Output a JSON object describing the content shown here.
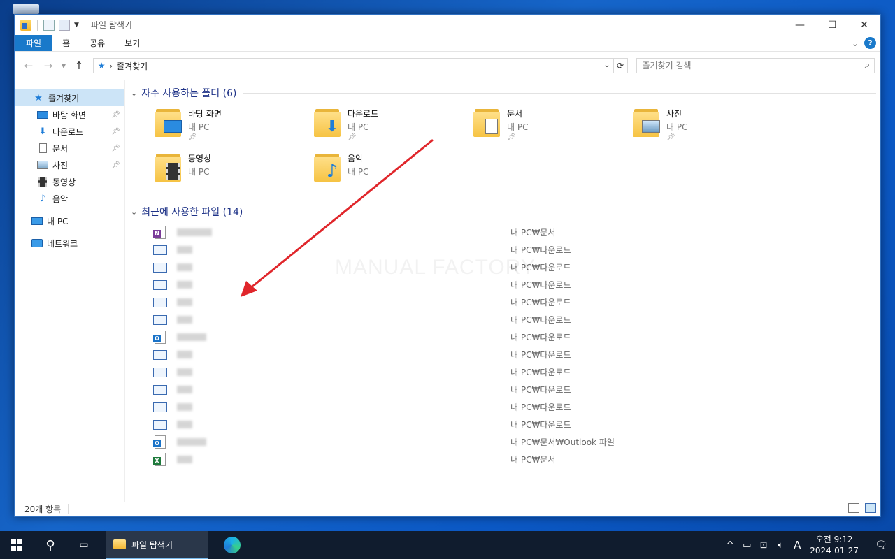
{
  "window": {
    "title": "파일 탐색기",
    "controls": {
      "minimize": "—",
      "maximize": "☐",
      "close": "✕"
    }
  },
  "ribbon": {
    "tabs": [
      "파일",
      "홈",
      "공유",
      "보기"
    ],
    "active_tab": "파일",
    "help": "?"
  },
  "address": {
    "crumb": "즐겨찾기",
    "search_placeholder": "즐겨찾기 검색"
  },
  "nav": {
    "quick_access": "즐겨찾기",
    "items": [
      {
        "label": "바탕 화면",
        "icon": "desktop-icon",
        "pinned": true
      },
      {
        "label": "다운로드",
        "icon": "download-icon",
        "pinned": true
      },
      {
        "label": "문서",
        "icon": "document-icon",
        "pinned": true
      },
      {
        "label": "사진",
        "icon": "picture-icon",
        "pinned": true
      },
      {
        "label": "동영상",
        "icon": "video-icon",
        "pinned": false
      },
      {
        "label": "음악",
        "icon": "music-icon",
        "pinned": false
      }
    ],
    "this_pc": "내 PC",
    "network": "네트워크"
  },
  "frequent": {
    "header": "자주 사용하는 폴더 (6)",
    "folders": [
      {
        "name": "바탕 화면",
        "sub": "내 PC",
        "pinned": true,
        "overlay": "desktop-icon"
      },
      {
        "name": "다운로드",
        "sub": "내 PC",
        "pinned": true,
        "overlay": "download-icon"
      },
      {
        "name": "문서",
        "sub": "내 PC",
        "pinned": true,
        "overlay": "document-icon"
      },
      {
        "name": "사진",
        "sub": "내 PC",
        "pinned": true,
        "overlay": "picture-icon"
      },
      {
        "name": "동영상",
        "sub": "내 PC",
        "pinned": false,
        "overlay": "video-icon"
      },
      {
        "name": "음악",
        "sub": "내 PC",
        "pinned": false,
        "overlay": "music-icon"
      }
    ]
  },
  "recent": {
    "header": "최근에 사용한 파일 (14)",
    "files": [
      {
        "type": "onenote",
        "path": "내 PC₩문서"
      },
      {
        "type": "window",
        "path": "내 PC₩다운로드"
      },
      {
        "type": "window",
        "path": "내 PC₩다운로드"
      },
      {
        "type": "window",
        "path": "내 PC₩다운로드"
      },
      {
        "type": "window",
        "path": "내 PC₩다운로드"
      },
      {
        "type": "window",
        "path": "내 PC₩다운로드"
      },
      {
        "type": "outlook",
        "path": "내 PC₩다운로드"
      },
      {
        "type": "window",
        "path": "내 PC₩다운로드"
      },
      {
        "type": "window",
        "path": "내 PC₩다운로드"
      },
      {
        "type": "window",
        "path": "내 PC₩다운로드"
      },
      {
        "type": "window",
        "path": "내 PC₩다운로드"
      },
      {
        "type": "window",
        "path": "내 PC₩다운로드"
      },
      {
        "type": "outlook",
        "path": "내 PC₩문서₩Outlook 파일"
      },
      {
        "type": "excel",
        "path": "내 PC₩문서"
      }
    ]
  },
  "watermark": "MANUAL FACTORY",
  "status": {
    "count": "20개 항목"
  },
  "taskbar": {
    "app_label": "파일 탐색기",
    "time": "오전 9:12",
    "date": "2024-01-27",
    "ime": "A"
  },
  "colors": {
    "accent": "#1979ca",
    "group_header": "#1e3287",
    "annotation_arrow": "#e0262b"
  }
}
